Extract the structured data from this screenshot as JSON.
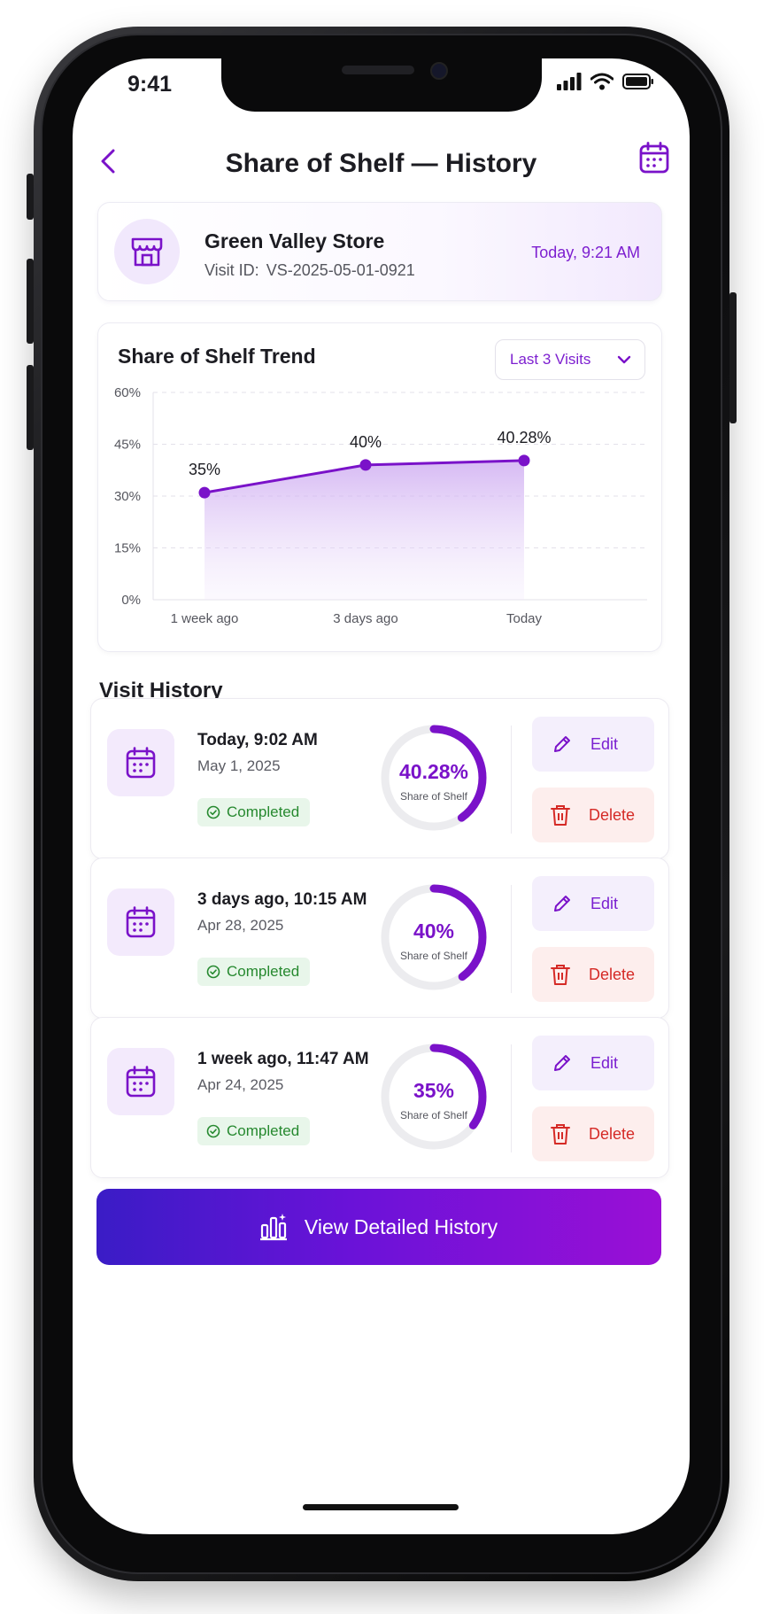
{
  "status": {
    "time": "9:41"
  },
  "header": {
    "title": "Share of Shelf — History"
  },
  "store": {
    "name": "Green Valley Store",
    "visit_id_label": "Visit ID:",
    "visit_id": "VS-2025-05-01-0921",
    "time": "Today, 9:21 AM"
  },
  "trend": {
    "title": "Share of Shelf Trend",
    "range": "Last 3 Visits"
  },
  "chart_data": {
    "type": "area",
    "title": "Share of Shelf Trend",
    "categories": [
      "1 week ago",
      "3 days ago",
      "Today"
    ],
    "values": [
      31,
      39,
      40.28
    ],
    "data_labels": [
      "35%",
      "40%",
      "40.28%"
    ],
    "yticks": [
      "60%",
      "45%",
      "30%",
      "15%",
      "0%"
    ],
    "ylim": [
      0,
      60
    ],
    "grid": true,
    "color": "#7a12c9"
  },
  "history": {
    "title": "Visit History",
    "items": [
      {
        "when": "Today, 9:02 AM",
        "date": "May 1, 2025",
        "status": "Completed",
        "percent": "40.28%",
        "value": 40.28,
        "metric": "Share of Shelf",
        "edit": "Edit",
        "delete": "Delete"
      },
      {
        "when": "3 days ago, 10:15 AM",
        "date": "Apr 28, 2025",
        "status": "Completed",
        "percent": "40%",
        "value": 40,
        "metric": "Share of Shelf",
        "edit": "Edit",
        "delete": "Delete"
      },
      {
        "when": "1 week ago, 11:47 AM",
        "date": "Apr 24, 2025",
        "status": "Completed",
        "percent": "35%",
        "value": 35,
        "metric": "Share of Shelf",
        "edit": "Edit",
        "delete": "Delete"
      }
    ]
  },
  "cta": {
    "label": "View Detailed History"
  },
  "colors": {
    "accent": "#7a12c9",
    "success": "#26892f",
    "danger": "#d52a26"
  }
}
